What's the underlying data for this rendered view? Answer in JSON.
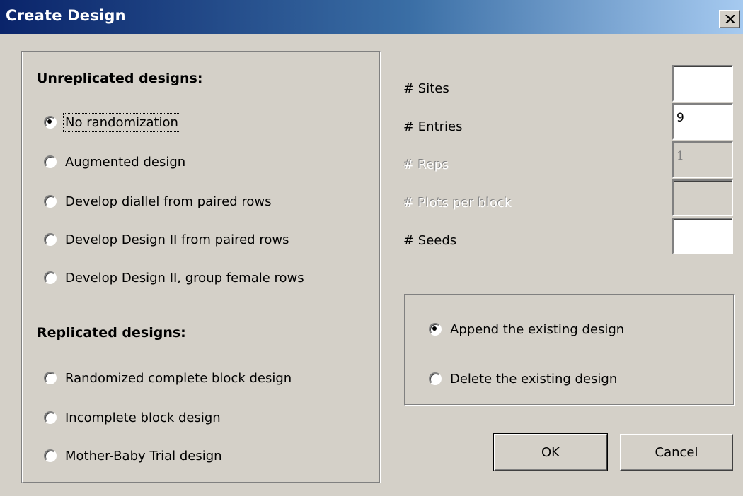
{
  "window": {
    "title": "Create Design",
    "close_icon": "close-icon"
  },
  "unreplicated": {
    "heading": "Unreplicated designs:",
    "options": [
      {
        "label": "No randomization",
        "checked": true
      },
      {
        "label": "Augmented design",
        "checked": false
      },
      {
        "label": "Develop diallel from paired rows",
        "checked": false
      },
      {
        "label": "Develop Design II from paired rows",
        "checked": false
      },
      {
        "label": "Develop Design II, group female rows",
        "checked": false
      }
    ]
  },
  "replicated": {
    "heading": "Replicated designs:",
    "options": [
      {
        "label": "Randomized complete block design",
        "checked": false
      },
      {
        "label": "Incomplete block design",
        "checked": false
      },
      {
        "label": "Mother-Baby Trial  design",
        "checked": false
      }
    ]
  },
  "fields": [
    {
      "label": "# Sites",
      "value": "",
      "enabled": true
    },
    {
      "label": "# Entries",
      "value": "9",
      "enabled": true
    },
    {
      "label": "# Reps",
      "value": "1",
      "enabled": false
    },
    {
      "label": "# Plots per block",
      "value": "",
      "enabled": false
    },
    {
      "label": "# Seeds",
      "value": "",
      "enabled": true
    }
  ],
  "existing": {
    "options": [
      {
        "label": "Append the existing design",
        "checked": true
      },
      {
        "label": "Delete the existing design",
        "checked": false
      }
    ]
  },
  "buttons": {
    "ok": "OK",
    "cancel": "Cancel"
  }
}
